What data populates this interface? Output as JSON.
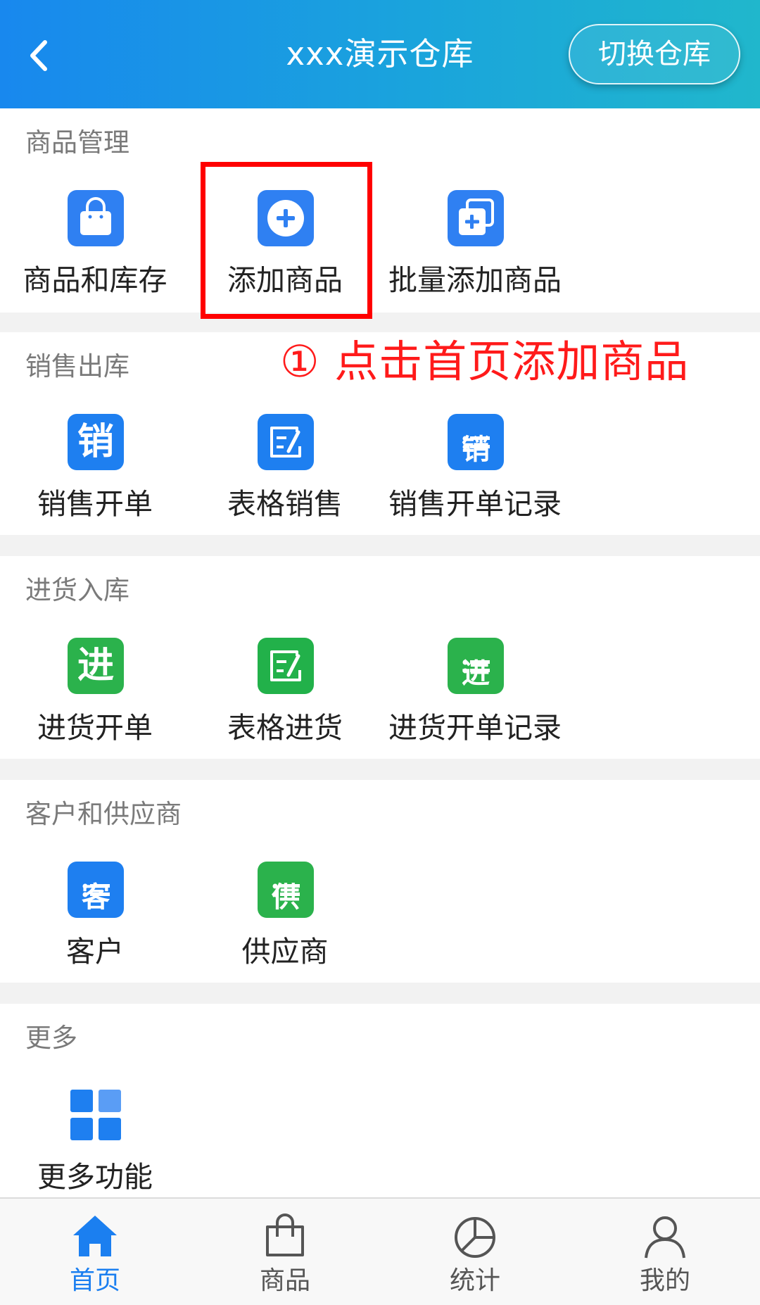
{
  "header": {
    "title": "xxx演示仓库",
    "switch_button": "切换仓库",
    "back_icon": "chevron-left-icon"
  },
  "sections": [
    {
      "title": "商品管理",
      "items": [
        {
          "label": "商品和库存",
          "icon": "shopping-bag-icon"
        },
        {
          "label": "添加商品",
          "icon": "plus-circle-icon"
        },
        {
          "label": "批量添加商品",
          "icon": "batch-add-icon"
        }
      ]
    },
    {
      "title": "销售出库",
      "items": [
        {
          "label": "销售开单",
          "icon": "sales-order-icon",
          "glyph": "销"
        },
        {
          "label": "表格销售",
          "icon": "table-edit-icon"
        },
        {
          "label": "销售开单记录",
          "icon": "sales-record-icon",
          "glyph": "销"
        }
      ]
    },
    {
      "title": "进货入库",
      "items": [
        {
          "label": "进货开单",
          "icon": "purchase-order-icon",
          "glyph": "进"
        },
        {
          "label": "表格进货",
          "icon": "table-edit-icon"
        },
        {
          "label": "进货开单记录",
          "icon": "purchase-record-icon",
          "glyph": "进"
        }
      ]
    },
    {
      "title": "客户和供应商",
      "items": [
        {
          "label": "客户",
          "icon": "customer-list-icon",
          "glyph": "客"
        },
        {
          "label": "供应商",
          "icon": "supplier-list-icon",
          "glyph": "供"
        }
      ]
    },
    {
      "title": "更多",
      "items": [
        {
          "label": "更多功能",
          "icon": "grid-icon"
        }
      ]
    }
  ],
  "annotation": {
    "callout": "① 点击首页添加商品",
    "color": "#ff0000"
  },
  "tabbar": [
    {
      "label": "首页",
      "icon": "home-icon",
      "active": true
    },
    {
      "label": "商品",
      "icon": "shopping-bag-outline-icon",
      "active": false
    },
    {
      "label": "统计",
      "icon": "pie-chart-icon",
      "active": false
    },
    {
      "label": "我的",
      "icon": "user-icon",
      "active": false
    }
  ],
  "colors": {
    "primary": "#1b7ff0",
    "sales_blue": "#1e7ff0",
    "purchase_green": "#2bb24c"
  }
}
